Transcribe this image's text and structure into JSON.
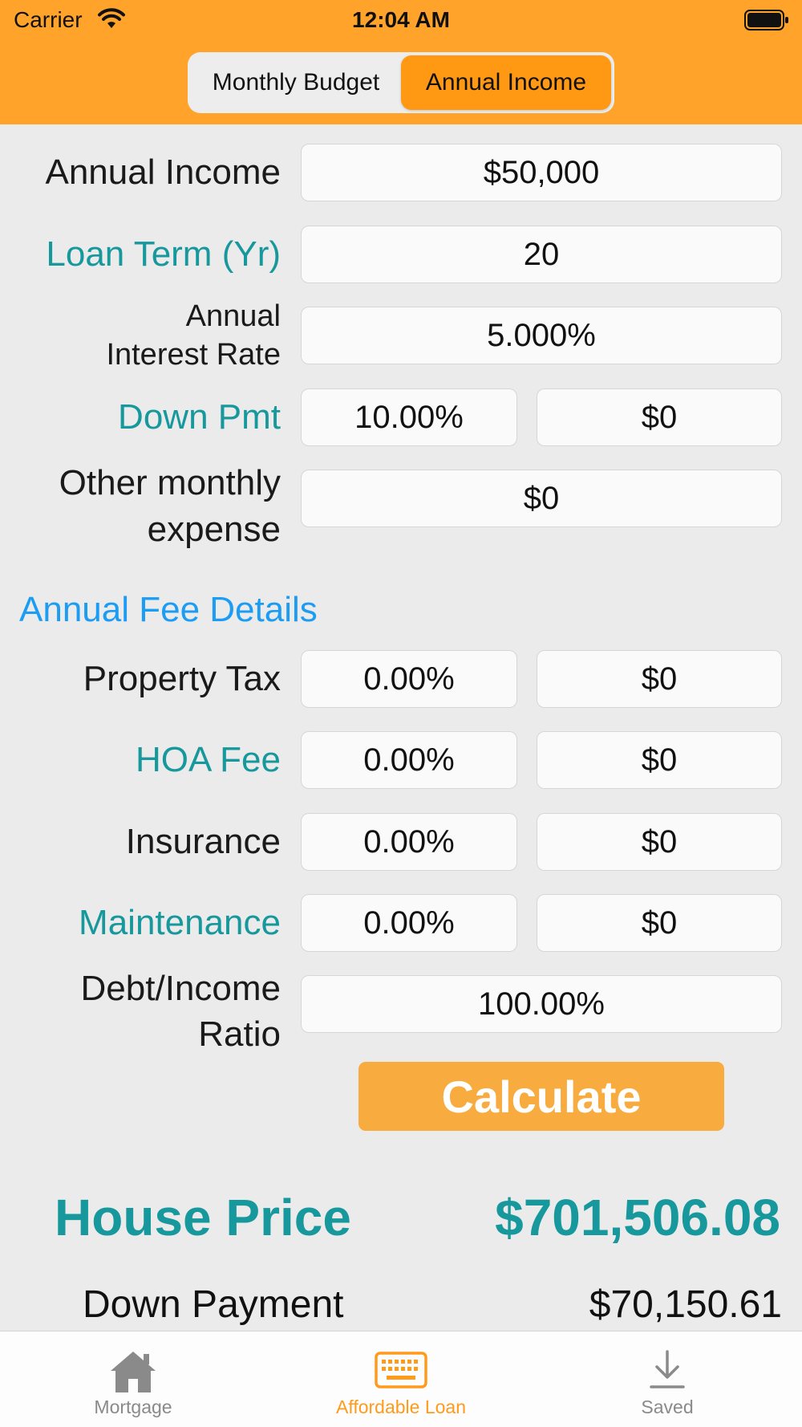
{
  "status_bar": {
    "carrier": "Carrier",
    "time": "12:04 AM"
  },
  "segmented": {
    "options": [
      "Monthly Budget",
      "Annual Income"
    ],
    "selected": "Annual Income"
  },
  "form": {
    "annual_income": {
      "label": "Annual Income",
      "value": "$50,000"
    },
    "loan_term": {
      "label": "Loan Term (Yr)",
      "value": "20"
    },
    "interest_rate": {
      "label_line1": "Annual",
      "label_line2": "Interest Rate",
      "value": "5.000%"
    },
    "down_pmt": {
      "label": "Down Pmt",
      "percent": "10.00%",
      "amount": "$0"
    },
    "other_expense": {
      "label_line1": "Other monthly",
      "label_line2": "expense",
      "value": "$0"
    }
  },
  "fees": {
    "title": "Annual Fee Details",
    "property_tax": {
      "label": "Property Tax",
      "percent": "0.00%",
      "amount": "$0"
    },
    "hoa_fee": {
      "label": "HOA Fee",
      "percent": "0.00%",
      "amount": "$0"
    },
    "insurance": {
      "label": "Insurance",
      "percent": "0.00%",
      "amount": "$0"
    },
    "maintenance": {
      "label": "Maintenance",
      "percent": "0.00%",
      "amount": "$0"
    },
    "debt_income": {
      "label_line1": "Debt/Income",
      "label_line2": "Ratio",
      "value": "100.00%"
    }
  },
  "calculate_label": "Calculate",
  "results": {
    "house_price_label": "House Price",
    "house_price_value": "$701,506.08",
    "down_payment_label": "Down Payment",
    "down_payment_value": "$70,150.61"
  },
  "tabs": [
    {
      "label": "Mortgage",
      "icon": "house-icon"
    },
    {
      "label": "Affordable Loan",
      "icon": "keyboard-icon"
    },
    {
      "label": "Saved",
      "icon": "download-icon"
    }
  ],
  "colors": {
    "header": "#ffa32b",
    "accent_teal": "#17989c",
    "accent_blue": "#1c9cf2",
    "calculate_button": "#f8ab3f",
    "active_tab": "#ff9a1b"
  }
}
